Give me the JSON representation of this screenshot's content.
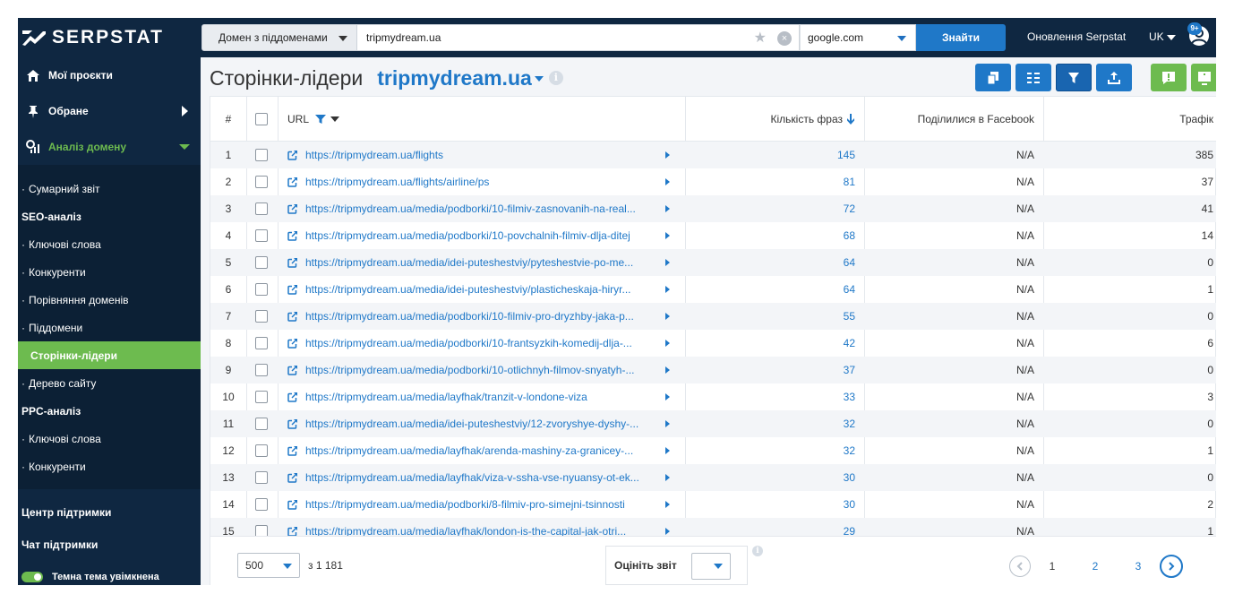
{
  "header": {
    "logo_text": "SERPSTAT",
    "domain_mode": "Домен з піддоменами",
    "search_value": "tripmydream.ua",
    "engine": "google.com",
    "find_label": "Знайти",
    "updates_label": "Оновлення Serpstat",
    "language": "UK",
    "notifications_badge": "9+"
  },
  "sidebar": {
    "top": [
      {
        "label": "Мої проєкти",
        "icon": "home-icon"
      },
      {
        "label": "Обране",
        "icon": "pin-icon"
      },
      {
        "label": "Аналіз домену",
        "icon": "analytics-icon"
      }
    ],
    "sub": [
      {
        "label": "Сумарний звіт",
        "type": "item"
      },
      {
        "label": "SEO-аналіз",
        "type": "group"
      },
      {
        "label": "Ключові слова",
        "type": "item"
      },
      {
        "label": "Конкуренти",
        "type": "item"
      },
      {
        "label": "Порівняння доменів",
        "type": "item"
      },
      {
        "label": "Піддомени",
        "type": "item"
      },
      {
        "label": "Сторінки-лідери",
        "type": "active"
      },
      {
        "label": "Дерево сайту",
        "type": "item"
      },
      {
        "label": "PPC-аналіз",
        "type": "group"
      },
      {
        "label": "Ключові слова",
        "type": "item"
      },
      {
        "label": "Конкуренти",
        "type": "item"
      }
    ],
    "support_center": "Центр підтримки",
    "support_chat": "Чат підтримки",
    "dark_theme": "Темна тема увімкнена"
  },
  "page": {
    "title": "Сторінки-лідери",
    "domain": "tripmydream.ua",
    "info_symbol": "i"
  },
  "table": {
    "columns": {
      "num": "#",
      "url": "URL",
      "phrases": "Кількість фраз",
      "facebook": "Поділилися в Facebook",
      "traffic": "Трафік"
    },
    "rows": [
      {
        "num": "1",
        "url": "https://tripmydream.ua/flights",
        "phrases": "145",
        "fb": "N/A",
        "traffic": "385"
      },
      {
        "num": "2",
        "url": "https://tripmydream.ua/flights/airline/ps",
        "phrases": "81",
        "fb": "N/A",
        "traffic": "37"
      },
      {
        "num": "3",
        "url": "https://tripmydream.ua/media/podborki/10-filmiv-zasnovanih-na-real...",
        "phrases": "72",
        "fb": "N/A",
        "traffic": "41"
      },
      {
        "num": "4",
        "url": "https://tripmydream.ua/media/podborki/10-povchalnih-filmiv-dlja-ditej",
        "phrases": "68",
        "fb": "N/A",
        "traffic": "14"
      },
      {
        "num": "5",
        "url": "https://tripmydream.ua/media/idei-puteshestviy/pyteshestvie-po-me...",
        "phrases": "64",
        "fb": "N/A",
        "traffic": "0"
      },
      {
        "num": "6",
        "url": "https://tripmydream.ua/media/idei-puteshestviy/plasticheskaja-hiryr...",
        "phrases": "64",
        "fb": "N/A",
        "traffic": "1"
      },
      {
        "num": "7",
        "url": "https://tripmydream.ua/media/podborki/10-filmiv-pro-dryzhby-jaka-p...",
        "phrases": "55",
        "fb": "N/A",
        "traffic": "0"
      },
      {
        "num": "8",
        "url": "https://tripmydream.ua/media/podborki/10-frantsyzkih-komedij-dlja-...",
        "phrases": "42",
        "fb": "N/A",
        "traffic": "6"
      },
      {
        "num": "9",
        "url": "https://tripmydream.ua/media/podborki/10-otlichnyh-filmov-snyatyh-...",
        "phrases": "37",
        "fb": "N/A",
        "traffic": "0"
      },
      {
        "num": "10",
        "url": "https://tripmydream.ua/media/layfhak/tranzit-v-londone-viza",
        "phrases": "33",
        "fb": "N/A",
        "traffic": "3"
      },
      {
        "num": "11",
        "url": "https://tripmydream.ua/media/idei-puteshestviy/12-zvoryshye-dyshy-...",
        "phrases": "32",
        "fb": "N/A",
        "traffic": "0"
      },
      {
        "num": "12",
        "url": "https://tripmydream.ua/media/layfhak/arenda-mashiny-za-granicey-...",
        "phrases": "32",
        "fb": "N/A",
        "traffic": "1"
      },
      {
        "num": "13",
        "url": "https://tripmydream.ua/media/layfhak/viza-v-ssha-vse-nyuansy-ot-ek...",
        "phrases": "30",
        "fb": "N/A",
        "traffic": "0"
      },
      {
        "num": "14",
        "url": "https://tripmydream.ua/media/podborki/8-filmiv-pro-simejni-tsinnosti",
        "phrases": "30",
        "fb": "N/A",
        "traffic": "2"
      },
      {
        "num": "15",
        "url": "https://tripmydream.ua/media/layfhak/london-is-the-capital-jak-otri...",
        "phrases": "29",
        "fb": "N/A",
        "traffic": "1"
      }
    ]
  },
  "footer": {
    "per_page": "500",
    "total": "з 1 181",
    "rate_label": "Оцініть звіт",
    "pages": [
      "1",
      "2",
      "3"
    ],
    "current_page": "1"
  },
  "colors": {
    "sidebar_bg": "#0f2741",
    "accent_blue": "#1f78c8",
    "accent_green": "#6dbb4f"
  }
}
